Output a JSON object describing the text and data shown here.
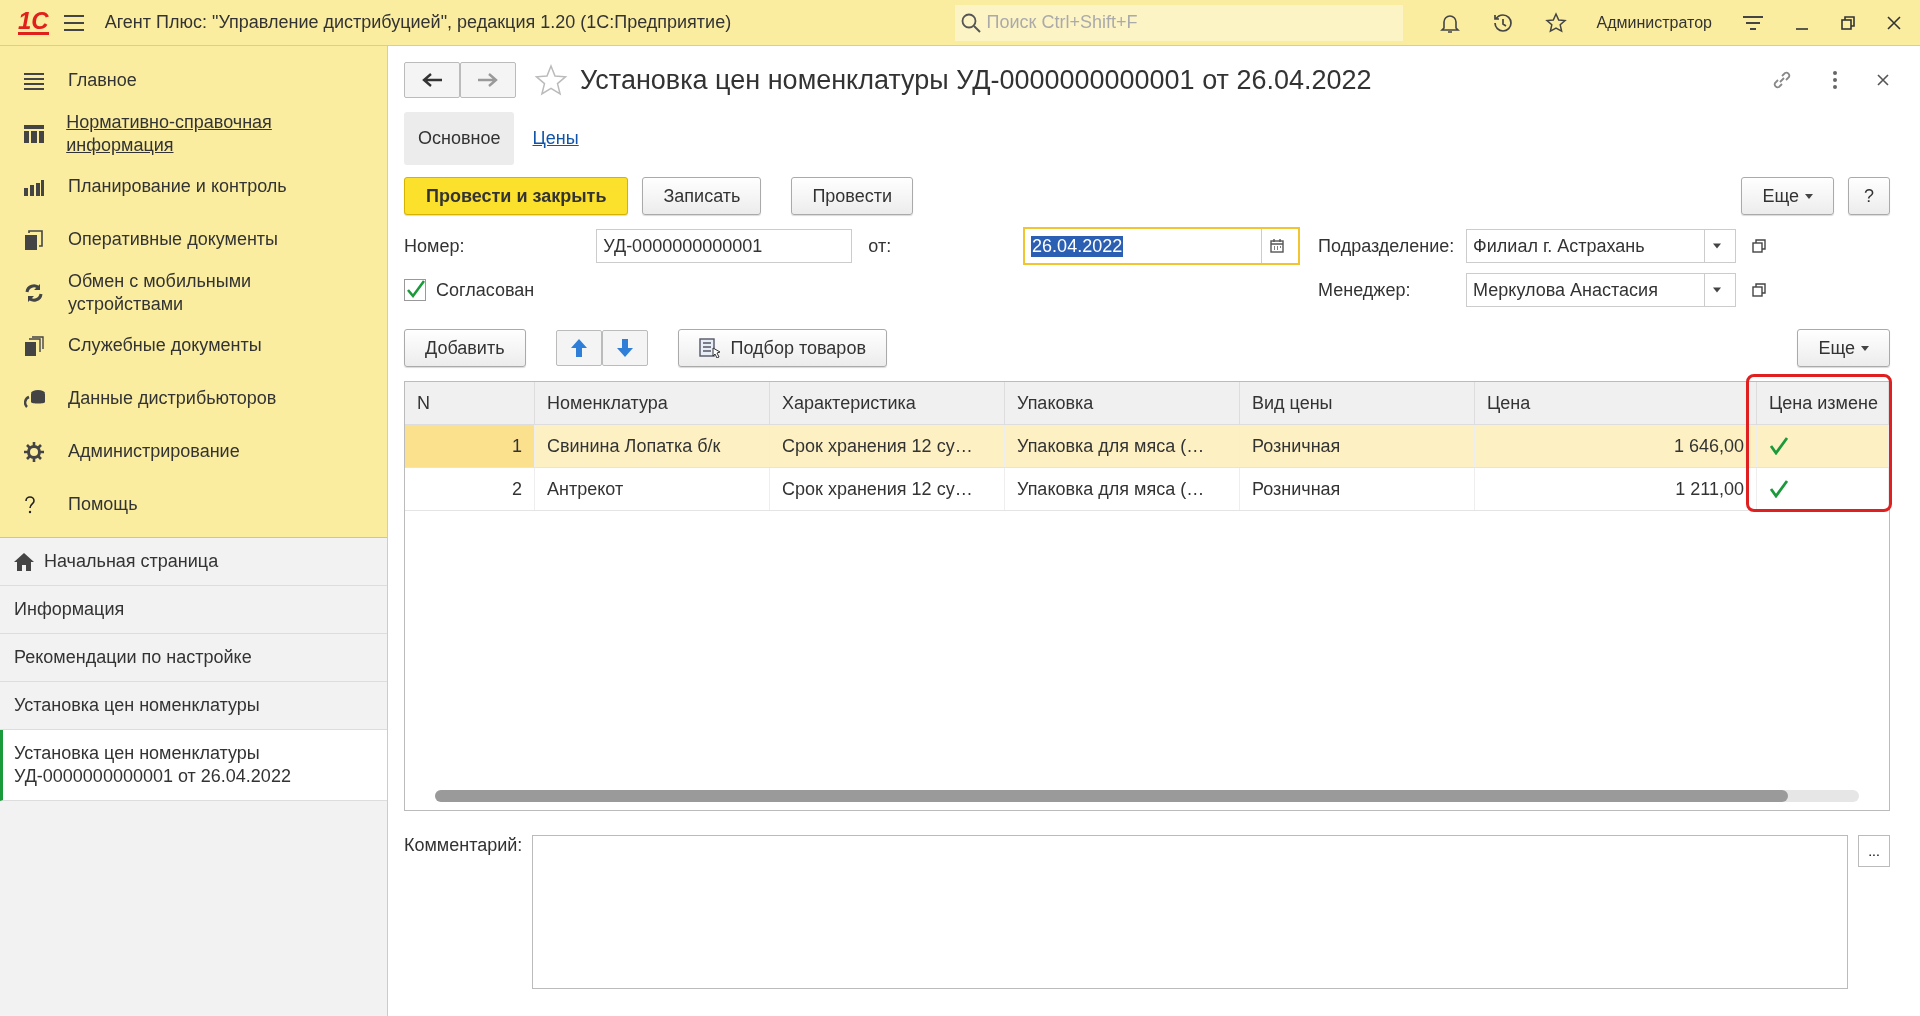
{
  "app_bar": {
    "logo": "1С",
    "title": "Агент Плюс: \"Управление дистрибуцией\", редакция 1.20  (1С:Предприятие)",
    "search": {
      "placeholder": "Поиск Ctrl+Shift+F"
    },
    "user": "Администратор"
  },
  "sections": [
    {
      "label": "Главное",
      "hovered": false
    },
    {
      "label": "Нормативно-справочная информация",
      "hovered": true
    },
    {
      "label": "Планирование и контроль",
      "hovered": false
    },
    {
      "label": "Оперативные документы",
      "hovered": false
    },
    {
      "label": "Обмен с мобильными устройствами",
      "hovered": false
    },
    {
      "label": "Служебные документы",
      "hovered": false
    },
    {
      "label": "Данные дистрибьюторов",
      "hovered": false
    },
    {
      "label": "Администрирование",
      "hovered": false
    },
    {
      "label": "Помощь",
      "hovered": false
    }
  ],
  "open_windows": [
    {
      "label": "Начальная страница",
      "selected": false
    },
    {
      "label": "Информация",
      "selected": false
    },
    {
      "label": "Рекомендации по настройке",
      "selected": false
    },
    {
      "label": "Установка цен номенклатуры",
      "selected": false
    },
    {
      "label": "Установка цен номенклатуры УД-0000000000001 от 26.04.2022",
      "selected": true
    }
  ],
  "document": {
    "title": "Установка цен номенклатуры УД-0000000000001 от 26.04.2022",
    "tabs": [
      {
        "label": "Основное",
        "selected": true
      },
      {
        "label": "Цены",
        "selected": false
      }
    ],
    "buttons": [
      {
        "label": "Провести и закрыть",
        "primary": true
      },
      {
        "label": "Записать",
        "primary": false
      },
      {
        "label": "Провести",
        "primary": false
      }
    ],
    "more_button": "Еще",
    "help_button": "?",
    "number": {
      "label": "Номер:",
      "value": "УД-0000000000001"
    },
    "date": {
      "label": "от:",
      "value": "26.04.2022"
    },
    "agreed": {
      "label": "Согласован",
      "checked": true
    },
    "division": {
      "label": "Подразделение:",
      "value": "Филиал г. Астрахань"
    },
    "manager": {
      "label": "Менеджер:",
      "value": "Меркулова Анастасия"
    },
    "table_toolbar": {
      "add": "Добавить",
      "pick": "Подбор товаров",
      "more": "Еще"
    },
    "table": {
      "columns": [
        "N",
        "Номенклатура",
        "Характеристика",
        "Упаковка",
        "Вид цены",
        "Цена",
        "Цена измене"
      ],
      "rows": [
        {
          "n": "1",
          "item": "Свинина Лопатка б/к",
          "characteristic": "Срок хранения 12 су…",
          "package": "Упаковка для мяса (…",
          "price_type": "Розничная",
          "price": "1 646,00",
          "price_changed": true,
          "selected": true
        },
        {
          "n": "2",
          "item": "Антрекот",
          "characteristic": "Срок хранения 12 су…",
          "package": "Упаковка для мяса (…",
          "price_type": "Розничная",
          "price": "1 211,00",
          "price_changed": true,
          "selected": false
        }
      ]
    },
    "comment": {
      "label": "Комментарий:",
      "button": "..."
    }
  }
}
